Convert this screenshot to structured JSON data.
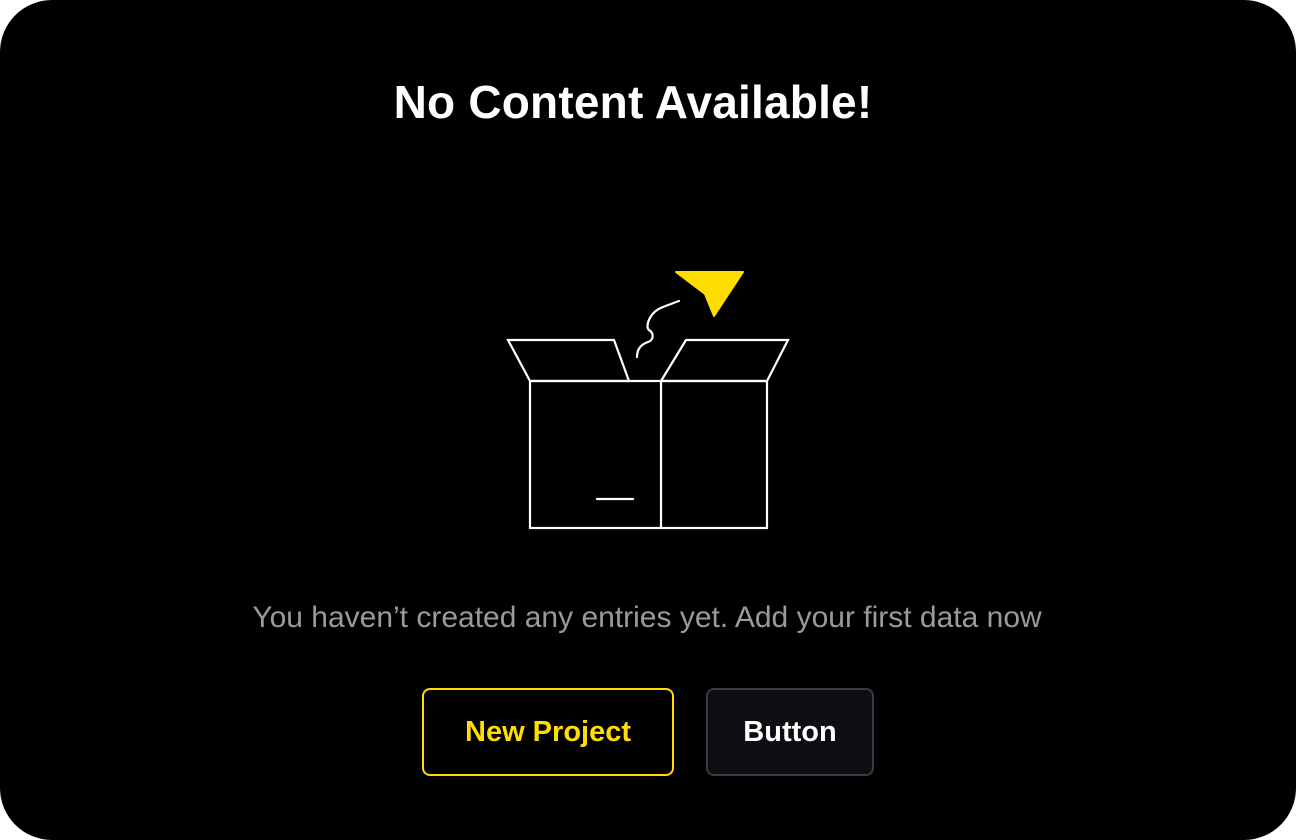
{
  "empty_state": {
    "title": "No Content Available!",
    "message": "You haven’t created any entries yet. Add your first data now",
    "illustration": "open-box-with-paper-plane-icon"
  },
  "actions": {
    "primary_label": "New Project",
    "secondary_label": "Button"
  },
  "colors": {
    "background": "#000000",
    "accent": "#FFDD00",
    "title": "#FFFFFF",
    "message": "#9A9A9A",
    "secondary_border": "#3A3A44"
  }
}
